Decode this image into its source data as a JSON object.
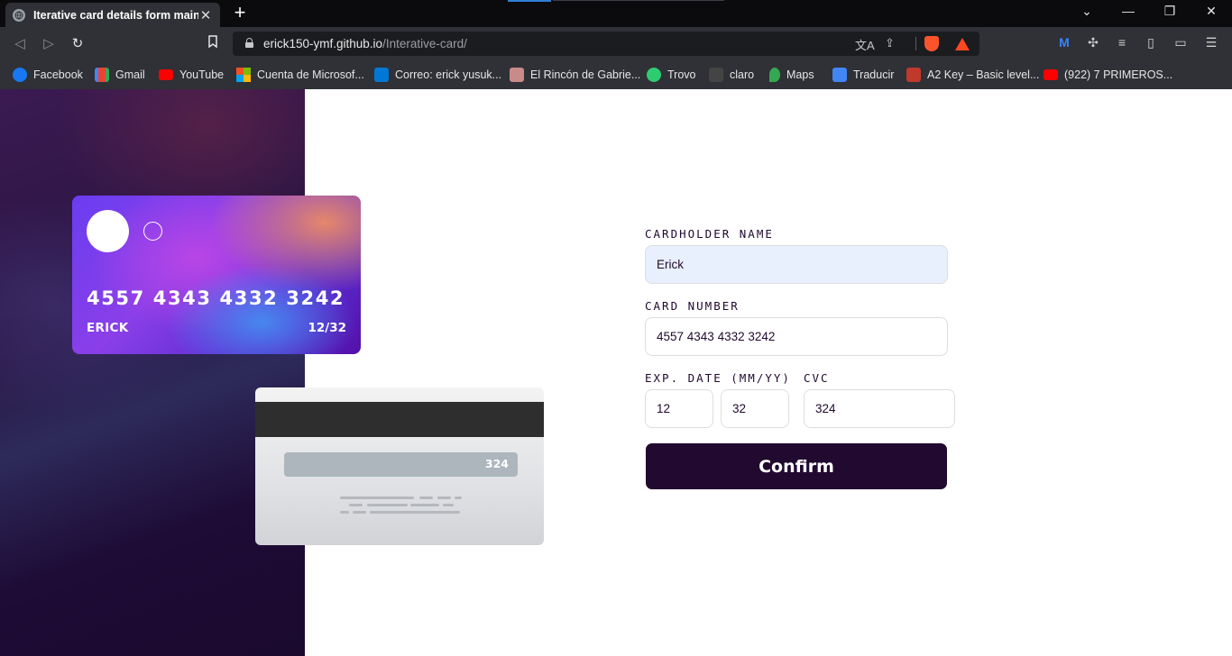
{
  "browser": {
    "tab_title": "Iterative card details form main",
    "tab_close": "✕",
    "new_tab": "+",
    "url_host": "erick150-ymf.github.io",
    "url_path": "/Interative-card/",
    "window_controls": [
      "⌄",
      "—",
      "❐",
      "✕"
    ]
  },
  "bookmarks": [
    {
      "label": "Facebook",
      "color": "#1877f2"
    },
    {
      "label": "Gmail",
      "color": "#ea4335"
    },
    {
      "label": "YouTube",
      "color": "#ff0000"
    },
    {
      "label": "Cuenta de Microsof...",
      "color": "#f25022"
    },
    {
      "label": "Correo: erick yusuk...",
      "color": "#0078d4"
    },
    {
      "label": "El Rincón de Gabrie...",
      "color": "#c98a8a"
    },
    {
      "label": "Trovo",
      "color": "#2ecc71"
    },
    {
      "label": "claro",
      "color": "#cfcfcf"
    },
    {
      "label": "Maps",
      "color": "#34a853"
    },
    {
      "label": "Traducir",
      "color": "#4285f4"
    },
    {
      "label": "A2 Key – Basic level...",
      "color": "#c0392b"
    },
    {
      "label": "(922) 7 PRIMEROS...",
      "color": "#ff0000"
    }
  ],
  "card": {
    "number": "4557 4343 4332 3242",
    "name": "ERICK",
    "exp": "12/32",
    "cvc": "324"
  },
  "form": {
    "cardholder_label": "CARDHOLDER NAME",
    "cardholder_value": "Erick",
    "number_label": "CARD NUMBER",
    "number_value": "4557 4343 4332 3242",
    "exp_label": "EXP. DATE (MM/YY)",
    "exp_month": "12",
    "exp_year": "32",
    "cvc_label": "CVC",
    "cvc_value": "324",
    "confirm_label": "Confirm"
  },
  "colors": {
    "button": "#21092f",
    "input_autofill": "#e8f0fe"
  }
}
